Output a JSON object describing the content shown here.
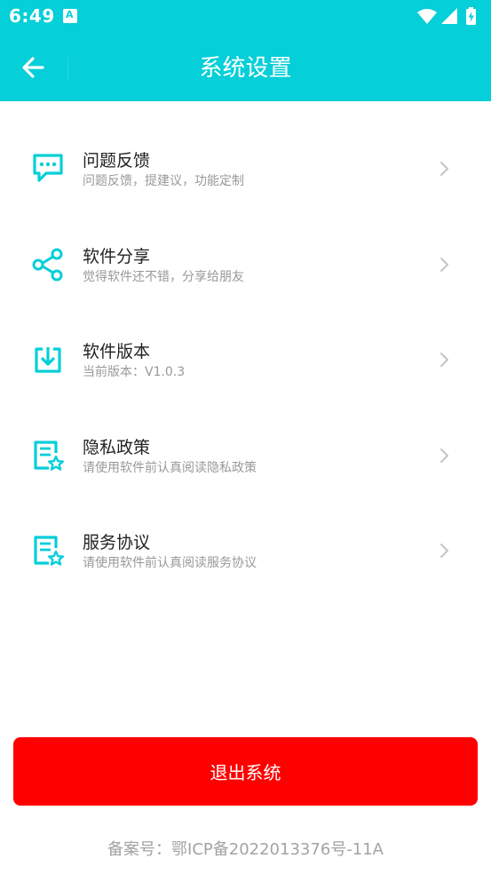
{
  "status": {
    "time": "6:49"
  },
  "header": {
    "title": "系统设置"
  },
  "menu": [
    {
      "label": "问题反馈",
      "desc": "问题反馈，提建议，功能定制",
      "icon": "feedback-icon"
    },
    {
      "label": "软件分享",
      "desc": "觉得软件还不错，分享给朋友",
      "icon": "share-icon"
    },
    {
      "label": "软件版本",
      "desc": "当前版本：V1.0.3",
      "icon": "download-icon"
    },
    {
      "label": "隐私政策",
      "desc": "请使用软件前认真阅读隐私政策",
      "icon": "document-star-icon"
    },
    {
      "label": "服务协议",
      "desc": "请使用软件前认真阅读服务协议",
      "icon": "document-star-icon"
    }
  ],
  "logout_label": "退出系统",
  "footer": {
    "icp": "备案号：鄂ICP备2022013376号-11A"
  },
  "colors": {
    "accent": "#05CFD8",
    "danger": "#FF0000"
  }
}
